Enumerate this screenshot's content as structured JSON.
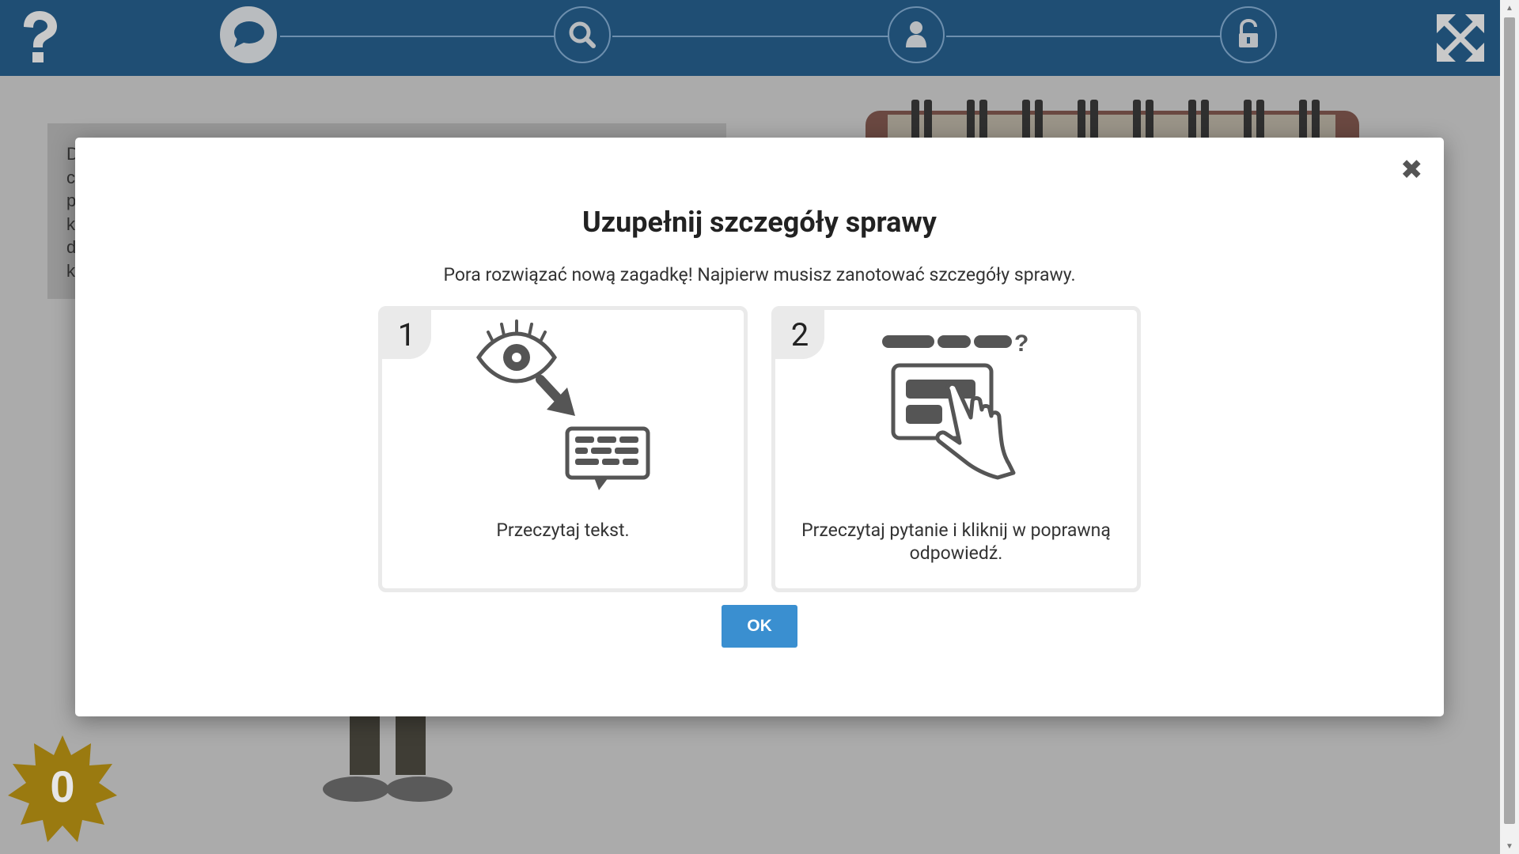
{
  "header": {
    "help_icon": "question-mark-icon",
    "fullscreen_icon": "expand-arrows-icon",
    "steps": [
      {
        "icon": "speech-bubble-icon",
        "active": true
      },
      {
        "icon": "magnifier-icon",
        "active": false
      },
      {
        "icon": "person-icon",
        "active": false
      },
      {
        "icon": "unlocked-padlock-icon",
        "active": false
      }
    ]
  },
  "background": {
    "text_initials": [
      "D",
      "c",
      "p",
      "k",
      "d",
      "k"
    ],
    "score_badge": "0"
  },
  "modal": {
    "close_icon": "close-x-icon",
    "title": "Uzupełnij szczegóły sprawy",
    "subtitle": "Pora rozwiązać nową zagadkę! Najpierw musisz zanotować szczegóły sprawy.",
    "cards": [
      {
        "number": "1",
        "icon": "eye-to-keyboard-icon",
        "text": "Przeczytaj tekst."
      },
      {
        "number": "2",
        "icon": "hand-tapping-answer-icon",
        "text": "Przeczytaj pytanie i kliknij w poprawną odpowiedź."
      }
    ],
    "ok_label": "OK"
  },
  "colors": {
    "header_bg": "#1f4e74",
    "overlay_bg": "#ababab",
    "ok_button": "#3a8fd0",
    "badge": "#b8860b"
  }
}
